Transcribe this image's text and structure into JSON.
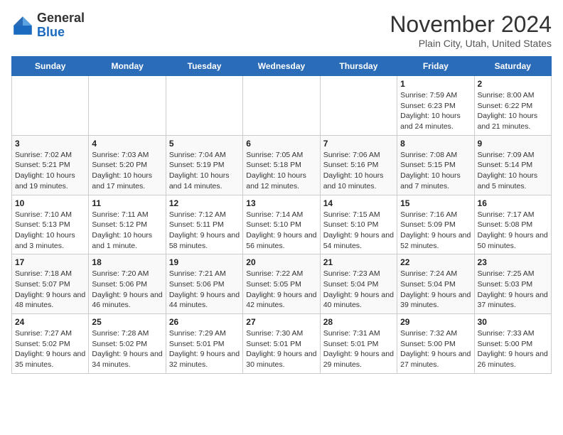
{
  "header": {
    "logo_line1": "General",
    "logo_line2": "Blue",
    "month_title": "November 2024",
    "location": "Plain City, Utah, United States"
  },
  "weekdays": [
    "Sunday",
    "Monday",
    "Tuesday",
    "Wednesday",
    "Thursday",
    "Friday",
    "Saturday"
  ],
  "weeks": [
    [
      {
        "day": "",
        "info": ""
      },
      {
        "day": "",
        "info": ""
      },
      {
        "day": "",
        "info": ""
      },
      {
        "day": "",
        "info": ""
      },
      {
        "day": "",
        "info": ""
      },
      {
        "day": "1",
        "info": "Sunrise: 7:59 AM\nSunset: 6:23 PM\nDaylight: 10 hours and 24 minutes."
      },
      {
        "day": "2",
        "info": "Sunrise: 8:00 AM\nSunset: 6:22 PM\nDaylight: 10 hours and 21 minutes."
      }
    ],
    [
      {
        "day": "3",
        "info": "Sunrise: 7:02 AM\nSunset: 5:21 PM\nDaylight: 10 hours and 19 minutes."
      },
      {
        "day": "4",
        "info": "Sunrise: 7:03 AM\nSunset: 5:20 PM\nDaylight: 10 hours and 17 minutes."
      },
      {
        "day": "5",
        "info": "Sunrise: 7:04 AM\nSunset: 5:19 PM\nDaylight: 10 hours and 14 minutes."
      },
      {
        "day": "6",
        "info": "Sunrise: 7:05 AM\nSunset: 5:18 PM\nDaylight: 10 hours and 12 minutes."
      },
      {
        "day": "7",
        "info": "Sunrise: 7:06 AM\nSunset: 5:16 PM\nDaylight: 10 hours and 10 minutes."
      },
      {
        "day": "8",
        "info": "Sunrise: 7:08 AM\nSunset: 5:15 PM\nDaylight: 10 hours and 7 minutes."
      },
      {
        "day": "9",
        "info": "Sunrise: 7:09 AM\nSunset: 5:14 PM\nDaylight: 10 hours and 5 minutes."
      }
    ],
    [
      {
        "day": "10",
        "info": "Sunrise: 7:10 AM\nSunset: 5:13 PM\nDaylight: 10 hours and 3 minutes."
      },
      {
        "day": "11",
        "info": "Sunrise: 7:11 AM\nSunset: 5:12 PM\nDaylight: 10 hours and 1 minute."
      },
      {
        "day": "12",
        "info": "Sunrise: 7:12 AM\nSunset: 5:11 PM\nDaylight: 9 hours and 58 minutes."
      },
      {
        "day": "13",
        "info": "Sunrise: 7:14 AM\nSunset: 5:10 PM\nDaylight: 9 hours and 56 minutes."
      },
      {
        "day": "14",
        "info": "Sunrise: 7:15 AM\nSunset: 5:10 PM\nDaylight: 9 hours and 54 minutes."
      },
      {
        "day": "15",
        "info": "Sunrise: 7:16 AM\nSunset: 5:09 PM\nDaylight: 9 hours and 52 minutes."
      },
      {
        "day": "16",
        "info": "Sunrise: 7:17 AM\nSunset: 5:08 PM\nDaylight: 9 hours and 50 minutes."
      }
    ],
    [
      {
        "day": "17",
        "info": "Sunrise: 7:18 AM\nSunset: 5:07 PM\nDaylight: 9 hours and 48 minutes."
      },
      {
        "day": "18",
        "info": "Sunrise: 7:20 AM\nSunset: 5:06 PM\nDaylight: 9 hours and 46 minutes."
      },
      {
        "day": "19",
        "info": "Sunrise: 7:21 AM\nSunset: 5:06 PM\nDaylight: 9 hours and 44 minutes."
      },
      {
        "day": "20",
        "info": "Sunrise: 7:22 AM\nSunset: 5:05 PM\nDaylight: 9 hours and 42 minutes."
      },
      {
        "day": "21",
        "info": "Sunrise: 7:23 AM\nSunset: 5:04 PM\nDaylight: 9 hours and 40 minutes."
      },
      {
        "day": "22",
        "info": "Sunrise: 7:24 AM\nSunset: 5:04 PM\nDaylight: 9 hours and 39 minutes."
      },
      {
        "day": "23",
        "info": "Sunrise: 7:25 AM\nSunset: 5:03 PM\nDaylight: 9 hours and 37 minutes."
      }
    ],
    [
      {
        "day": "24",
        "info": "Sunrise: 7:27 AM\nSunset: 5:02 PM\nDaylight: 9 hours and 35 minutes."
      },
      {
        "day": "25",
        "info": "Sunrise: 7:28 AM\nSunset: 5:02 PM\nDaylight: 9 hours and 34 minutes."
      },
      {
        "day": "26",
        "info": "Sunrise: 7:29 AM\nSunset: 5:01 PM\nDaylight: 9 hours and 32 minutes."
      },
      {
        "day": "27",
        "info": "Sunrise: 7:30 AM\nSunset: 5:01 PM\nDaylight: 9 hours and 30 minutes."
      },
      {
        "day": "28",
        "info": "Sunrise: 7:31 AM\nSunset: 5:01 PM\nDaylight: 9 hours and 29 minutes."
      },
      {
        "day": "29",
        "info": "Sunrise: 7:32 AM\nSunset: 5:00 PM\nDaylight: 9 hours and 27 minutes."
      },
      {
        "day": "30",
        "info": "Sunrise: 7:33 AM\nSunset: 5:00 PM\nDaylight: 9 hours and 26 minutes."
      }
    ]
  ]
}
